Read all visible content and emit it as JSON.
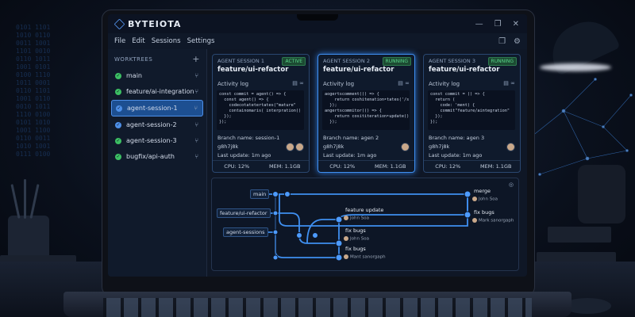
{
  "app": {
    "name": "BYTEIOTA",
    "window_controls": [
      "—",
      "❐",
      "✕"
    ]
  },
  "menu": {
    "items": [
      "File",
      "Edit",
      "Sessions",
      "Settings"
    ],
    "right_icons": [
      "❐",
      "⚙"
    ]
  },
  "sidebar": {
    "heading": "WORKTREES",
    "add_label": "+",
    "items": [
      {
        "label": "main",
        "status": "ok"
      },
      {
        "label": "feature/ai-integration",
        "status": "ok"
      },
      {
        "label": "agent-session-1",
        "status": "ok",
        "active": true
      },
      {
        "label": "agent-session-2",
        "status": "ok"
      },
      {
        "label": "agent-session-3",
        "status": "ok"
      },
      {
        "label": "bugfix/api-auth",
        "status": "ok"
      }
    ]
  },
  "cards": [
    {
      "heading": "AGENT SESSION 1",
      "badge": "ACTIVE",
      "title": "feature/ui-refactor",
      "log_label": "Activity log",
      "code": "const commit = agent() => {\n  const agent() => {\n    codecotatetertates(\"mature\"\n    containomaris( interpration()\n  });\n});",
      "branch": "Branch name: session-1",
      "hash": "g8h7j8k",
      "update": "Last update: 1m ago",
      "cpu": "CPU: 12%",
      "mem": "MEM: 1.1GB"
    },
    {
      "heading": "AGENT SESSION 2",
      "badge": "RUNNING",
      "title": "feature/ui-refactor",
      "log_label": "Activity log",
      "code": "aogertscomment(() => {\n    return coshitenation‣tates('/s\n  });\nangertscommitor(() => {\n    return cosititeration‣update();\n  });",
      "branch": "Branch name: agen 2",
      "hash": "g8h7j8k",
      "update": "Last update: 1m ago",
      "cpu": "CPU: 12%",
      "mem": "MEM: 1.1GB"
    },
    {
      "heading": "AGENT SESSION 3",
      "badge": "RUNNING",
      "title": "feature/ui-refactor",
      "log_label": "Activity log",
      "code": "const commit = () => {\n  return (\n    code: 'ment) {\n    commit\"feature/aintegration\"\n  });\n});",
      "branch": "Branch name: agen 3",
      "hash": "g8h7j8k",
      "update": "Last update: 1m ago",
      "cpu": "CPU: 12%",
      "mem": "MEM: 1.1GB"
    }
  ],
  "graph": {
    "branches": [
      "main",
      "feature/ui-refactor",
      "agent-sessions"
    ],
    "commits": [
      {
        "label": "merge",
        "author": "John Soa"
      },
      {
        "label": "fix bugs",
        "author": "Mark sanorgaph"
      },
      {
        "label": "feature update",
        "author": "John Soa"
      },
      {
        "label": "fix bugs",
        "author": "John Soa"
      },
      {
        "label": "fix bugs",
        "author": "Mant sanorgaph"
      }
    ],
    "icon": "github-icon"
  },
  "colors": {
    "accent": "#3f8ff0",
    "success": "#3cbf63",
    "bg": "#0f1726"
  }
}
